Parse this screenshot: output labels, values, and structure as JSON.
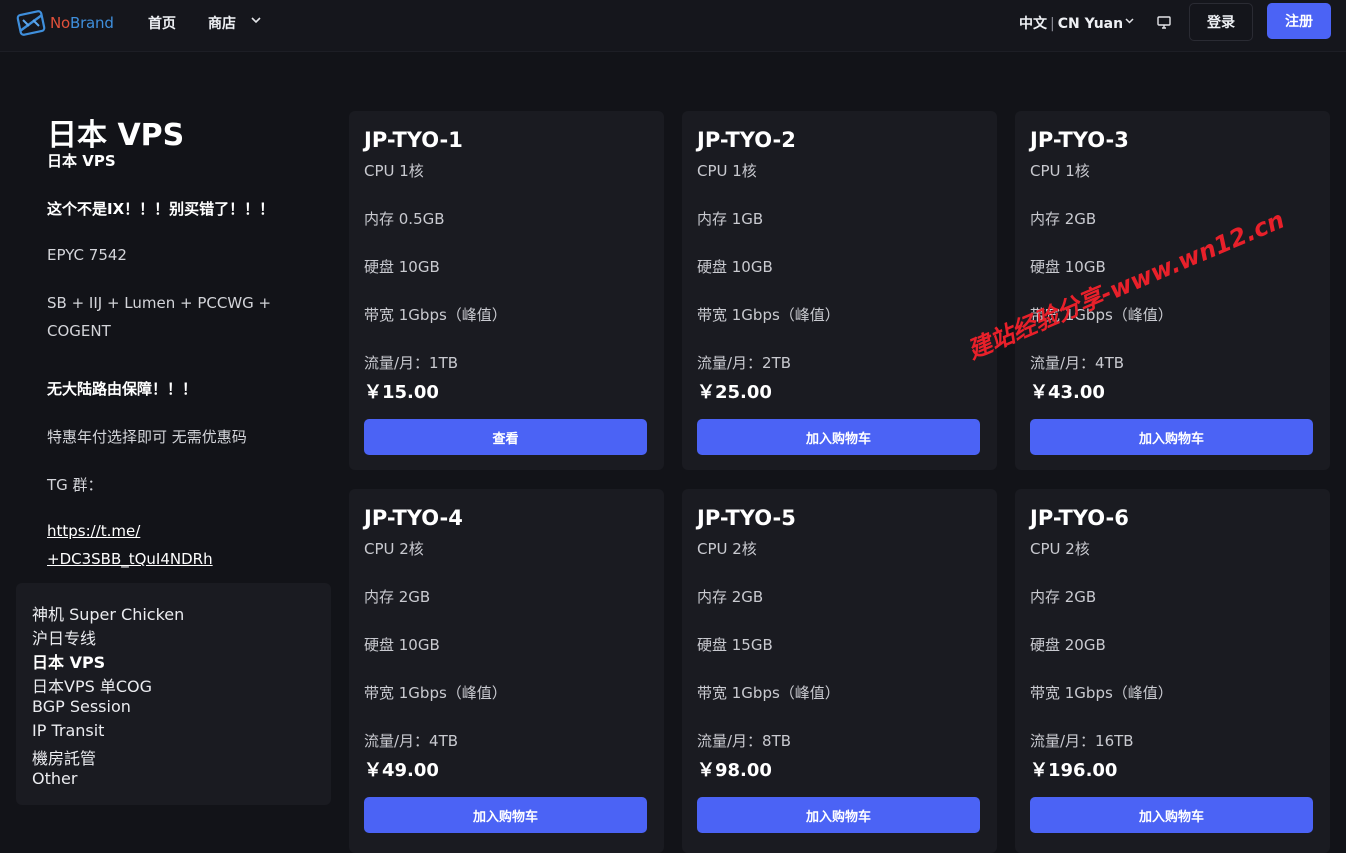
{
  "nav": {
    "logo": {
      "part1": "No",
      "part2": "Brand"
    },
    "home": "首页",
    "shop": "商店",
    "language": "中文",
    "currency": "CN Yuan",
    "login": "登录",
    "register": "注册"
  },
  "sidebar": {
    "title": "日本 VPS",
    "subtitle": "日本 VPS",
    "warning": "这个不是IX！！！别买错了！！！",
    "cpu": "EPYC 7542",
    "network_line1": "SB + IIJ + Lumen + PCCWG +",
    "network_line2": "COGENT",
    "route_note": "无大陆路由保障！！！",
    "discount_note": "特惠年付选择即可 无需优惠码",
    "tg_label": "TG 群：",
    "tg_link_line1": "https://t.me/",
    "tg_link_line2": "+DC3SBB_tQuI4NDRh",
    "categories": [
      "神机 Super Chicken",
      "沪日专线",
      "日本 VPS",
      "日本VPS 单COG",
      "BGP Session",
      "IP Transit",
      "機房託管",
      "Other"
    ]
  },
  "products": [
    {
      "name": "JP-TYO-1",
      "cpu": "CPU 1核",
      "ram": "内存 0.5GB",
      "disk": "硬盘 10GB",
      "bandwidth": "带宽 1Gbps（峰值）",
      "traffic": "流量/月：1TB",
      "price": "￥15.00",
      "button": "查看"
    },
    {
      "name": "JP-TYO-2",
      "cpu": "CPU 1核",
      "ram": "内存 1GB",
      "disk": "硬盘 10GB",
      "bandwidth": "带宽 1Gbps（峰值）",
      "traffic": "流量/月：2TB",
      "price": "￥25.00",
      "button": "加入购物车"
    },
    {
      "name": "JP-TYO-3",
      "cpu": "CPU 1核",
      "ram": "内存 2GB",
      "disk": "硬盘 10GB",
      "bandwidth": "带宽 1Gbps（峰值）",
      "traffic": "流量/月：4TB",
      "price": "￥43.00",
      "button": "加入购物车"
    },
    {
      "name": "JP-TYO-4",
      "cpu": "CPU 2核",
      "ram": "内存 2GB",
      "disk": "硬盘 10GB",
      "bandwidth": "带宽 1Gbps（峰值）",
      "traffic": "流量/月：4TB",
      "price": "￥49.00",
      "button": "加入购物车"
    },
    {
      "name": "JP-TYO-5",
      "cpu": "CPU 2核",
      "ram": "内存 2GB",
      "disk": "硬盘 15GB",
      "bandwidth": "带宽 1Gbps（峰值）",
      "traffic": "流量/月：8TB",
      "price": "￥98.00",
      "button": "加入购物车"
    },
    {
      "name": "JP-TYO-6",
      "cpu": "CPU 2核",
      "ram": "内存 2GB",
      "disk": "硬盘 20GB",
      "bandwidth": "带宽 1Gbps（峰值）",
      "traffic": "流量/月：16TB",
      "price": "￥196.00",
      "button": "加入购物车"
    }
  ],
  "watermark": "建站经验分享-www.wn12.cn",
  "colors": {
    "background": "#121318",
    "card": "#1a1b21",
    "accent": "#4b63f5",
    "watermark": "#e8202a"
  },
  "icons": [
    "logo-icon",
    "chevron-down-icon",
    "monitor-icon"
  ]
}
